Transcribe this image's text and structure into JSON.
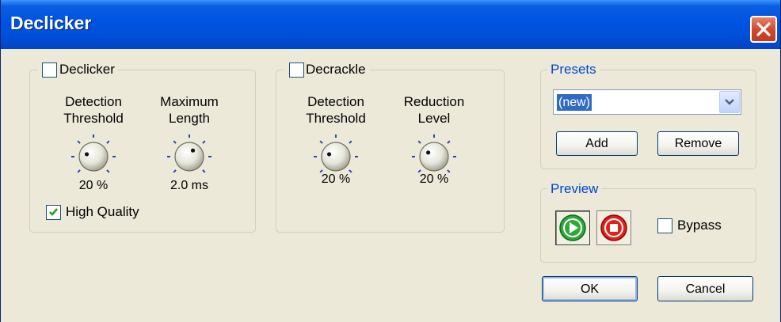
{
  "window": {
    "title": "Declicker"
  },
  "declicker_group": {
    "label": "Declicker",
    "checked": false,
    "knobs": [
      {
        "label_line1": "Detection",
        "label_line2": "Threshold",
        "value": "20 %"
      },
      {
        "label_line1": "Maximum",
        "label_line2": "Length",
        "value": "2.0 ms"
      }
    ],
    "high_quality": {
      "label": "High Quality",
      "checked": true
    }
  },
  "decrackle_group": {
    "label": "Decrackle",
    "checked": false,
    "knobs": [
      {
        "label_line1": "Detection",
        "label_line2": "Threshold",
        "value": "20 %"
      },
      {
        "label_line1": "Reduction",
        "label_line2": "Level",
        "value": "20 %"
      }
    ]
  },
  "presets": {
    "label": "Presets",
    "selected": "(new)",
    "add_label": "Add",
    "remove_label": "Remove"
  },
  "preview": {
    "label": "Preview",
    "play_icon": "play-icon",
    "stop_icon": "stop-icon",
    "bypass_label": "Bypass",
    "bypass_checked": false
  },
  "buttons": {
    "ok_label": "OK",
    "cancel_label": "Cancel"
  },
  "colors": {
    "title_bar": "#0054e3",
    "face": "#ece9d8",
    "group_title_blue": "#0046d5"
  }
}
